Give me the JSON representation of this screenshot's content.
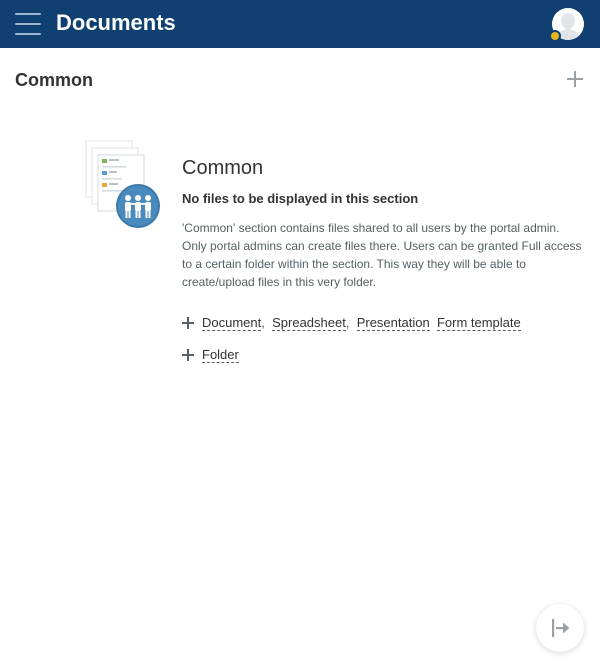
{
  "header": {
    "app_title": "Documents",
    "menu_icon": "hamburger-menu-icon",
    "avatar_icon": "user-avatar-icon",
    "badge_color": "#e8b91f",
    "bar_color": "#0f4071"
  },
  "section": {
    "title": "Common",
    "add_icon": "plus-icon"
  },
  "empty_state": {
    "illustration_icon": "shared-documents-people-icon",
    "title": "Common",
    "subtitle": "No files to be displayed in this section",
    "description": "'Common' section contains files shared to all users by the portal admin. Only portal admins can create files there. Users can be granted Full access to a certain folder within the section. This way they will be able to create/upload files in this very folder.",
    "create_links": {
      "document": "Document",
      "spreadsheet": "Spreadsheet",
      "presentation": "Presentation",
      "form_template": "Form template",
      "folder": "Folder"
    },
    "separator": ","
  },
  "footer": {
    "logout_icon": "logout-arrow-icon"
  }
}
